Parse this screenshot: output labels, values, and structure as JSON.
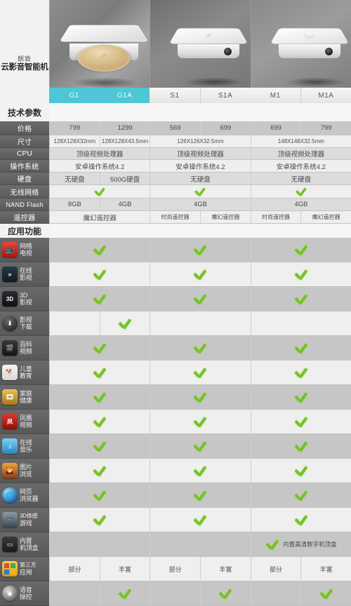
{
  "brand": {
    "top_line": "朗致",
    "main_line": "云影音智能机"
  },
  "colors": {
    "active_tab": "#4ec6d6",
    "check_green": "#76c124",
    "label_bar": "#6a6a6a"
  },
  "products": [
    {
      "group": "G",
      "active": true,
      "tabs": [
        "G1",
        "G1A"
      ],
      "image": "gold-disc-box"
    },
    {
      "group": "S",
      "active": false,
      "tabs": [
        "S1",
        "S1A"
      ],
      "image": "white-box-logo"
    },
    {
      "group": "M",
      "active": false,
      "tabs": [
        "M1",
        "M1A"
      ],
      "image": "white-box-dome"
    }
  ],
  "sections": {
    "specs_title": "技术参数",
    "apps_title": "应用功能"
  },
  "spec_rows": [
    {
      "label": "价格",
      "cells": [
        "799",
        "1299",
        "569",
        "699",
        "699",
        "799"
      ],
      "span": false,
      "shade": "dark"
    },
    {
      "label": "尺寸",
      "cells": [
        "128X128X32mm",
        "128X128X43.5mm",
        "126X126X32.5mm",
        "148X148X32.5mm"
      ],
      "span": "mixed-a",
      "shade": "light"
    },
    {
      "label": "CPU",
      "cells": [
        "顶级视频处理器",
        "顶级视频处理器",
        "顶级视频处理器"
      ],
      "span": "all",
      "shade": "shade"
    },
    {
      "label": "操作系统",
      "cells": [
        "安卓操作系统4.2",
        "安卓操作系统4.2",
        "安卓操作系统4.2"
      ],
      "span": "all",
      "shade": "light"
    },
    {
      "label": "硬盘",
      "cells": [
        "无硬盘",
        "500G硬盘",
        "无硬盘",
        "无硬盘"
      ],
      "span": "mixed-b",
      "shade": "shade"
    },
    {
      "label": "无线网络",
      "cells": [
        "check",
        "check",
        "check"
      ],
      "span": "all",
      "shade": "light"
    },
    {
      "label": "NAND Flash",
      "cells": [
        "8GB",
        "4GB",
        "4GB",
        "4GB"
      ],
      "span": "mixed-b",
      "shade": "shade"
    },
    {
      "label": "遥控器",
      "cells": [
        "魔幻遥控器",
        "时尚遥控器",
        "魔幻遥控器",
        "时尚遥控器",
        "魔幻遥控器"
      ],
      "span": "remote",
      "shade": "light"
    }
  ],
  "app_rows": [
    {
      "icon": "network-tv-icon",
      "icon_style": "ic-red",
      "glyph": "📺",
      "line1": "网络",
      "line2": "电视",
      "g": "check",
      "s": "check",
      "m": "check"
    },
    {
      "icon": "online-video-icon",
      "icon_style": "ic-teal",
      "glyph": "»",
      "line1": "在线",
      "line2": "影视",
      "g": "check",
      "s": "check",
      "m": "check"
    },
    {
      "icon": "three-d-video-icon",
      "icon_style": "ic-dark",
      "glyph": "3D",
      "line1": "3D",
      "line2": "影视",
      "g": "check",
      "s": "check",
      "m": "check"
    },
    {
      "icon": "download-icon",
      "icon_style": "ic-black",
      "glyph": "⬇",
      "line1": "影视",
      "line2": "下载",
      "g": "g1a-only",
      "s": "none",
      "m": "none"
    },
    {
      "icon": "encyclopedia-icon",
      "icon_style": "ic-film",
      "glyph": "🎬",
      "line1": "百科",
      "line2": "视频",
      "g": "check",
      "s": "check",
      "m": "check"
    },
    {
      "icon": "kids-edu-icon",
      "icon_style": "ic-dog",
      "glyph": "🐕",
      "line1": "儿童",
      "line2": "教育",
      "g": "check",
      "s": "check",
      "m": "check"
    },
    {
      "icon": "family-health-icon",
      "icon_style": "ic-gold",
      "glyph": "🎞",
      "line1": "家庭",
      "line2": "健康",
      "g": "check",
      "s": "check",
      "m": "check"
    },
    {
      "icon": "phoenix-video-icon",
      "icon_style": "ic-phx",
      "glyph": "凤",
      "line1": "凤凰",
      "line2": "视频",
      "g": "check",
      "s": "check",
      "m": "check"
    },
    {
      "icon": "online-music-icon",
      "icon_style": "ic-blue",
      "glyph": "♫",
      "line1": "在线",
      "line2": "音乐",
      "g": "check",
      "s": "check",
      "m": "check"
    },
    {
      "icon": "photo-browse-icon",
      "icon_style": "ic-sun",
      "glyph": "🌄",
      "line1": "图片",
      "line2": "浏览",
      "g": "check",
      "s": "check",
      "m": "check"
    },
    {
      "icon": "web-browser-icon",
      "icon_style": "ic-globe",
      "glyph": "🌐",
      "line1": "网页",
      "line2": "浏览器",
      "g": "check",
      "s": "check",
      "m": "check"
    },
    {
      "icon": "motion-game-icon",
      "icon_style": "ic-game",
      "glyph": "🎮",
      "line1": "3D体感",
      "line2": "游戏",
      "g": "check",
      "s": "check",
      "m": "check"
    },
    {
      "icon": "set-top-box-icon",
      "icon_style": "ic-stb",
      "glyph": "▭",
      "line1": "内置",
      "line2": "机顶盒",
      "g": "none",
      "s": "none",
      "m": "check-note",
      "note": "内置高清数字机顶盒"
    },
    {
      "icon": "third-party-app-icon",
      "icon_style": "ic-win",
      "glyph": "",
      "line1": "第三方",
      "line2": "应用",
      "g": "text",
      "s": "text",
      "m": "text",
      "text_a": "部分",
      "text_b": "丰富"
    },
    {
      "icon": "voice-control-icon",
      "icon_style": "ic-mic",
      "glyph": "◉",
      "line1": "语音",
      "line2": "操控",
      "g": "second-only",
      "s": "second-only",
      "m": "second-only"
    }
  ]
}
